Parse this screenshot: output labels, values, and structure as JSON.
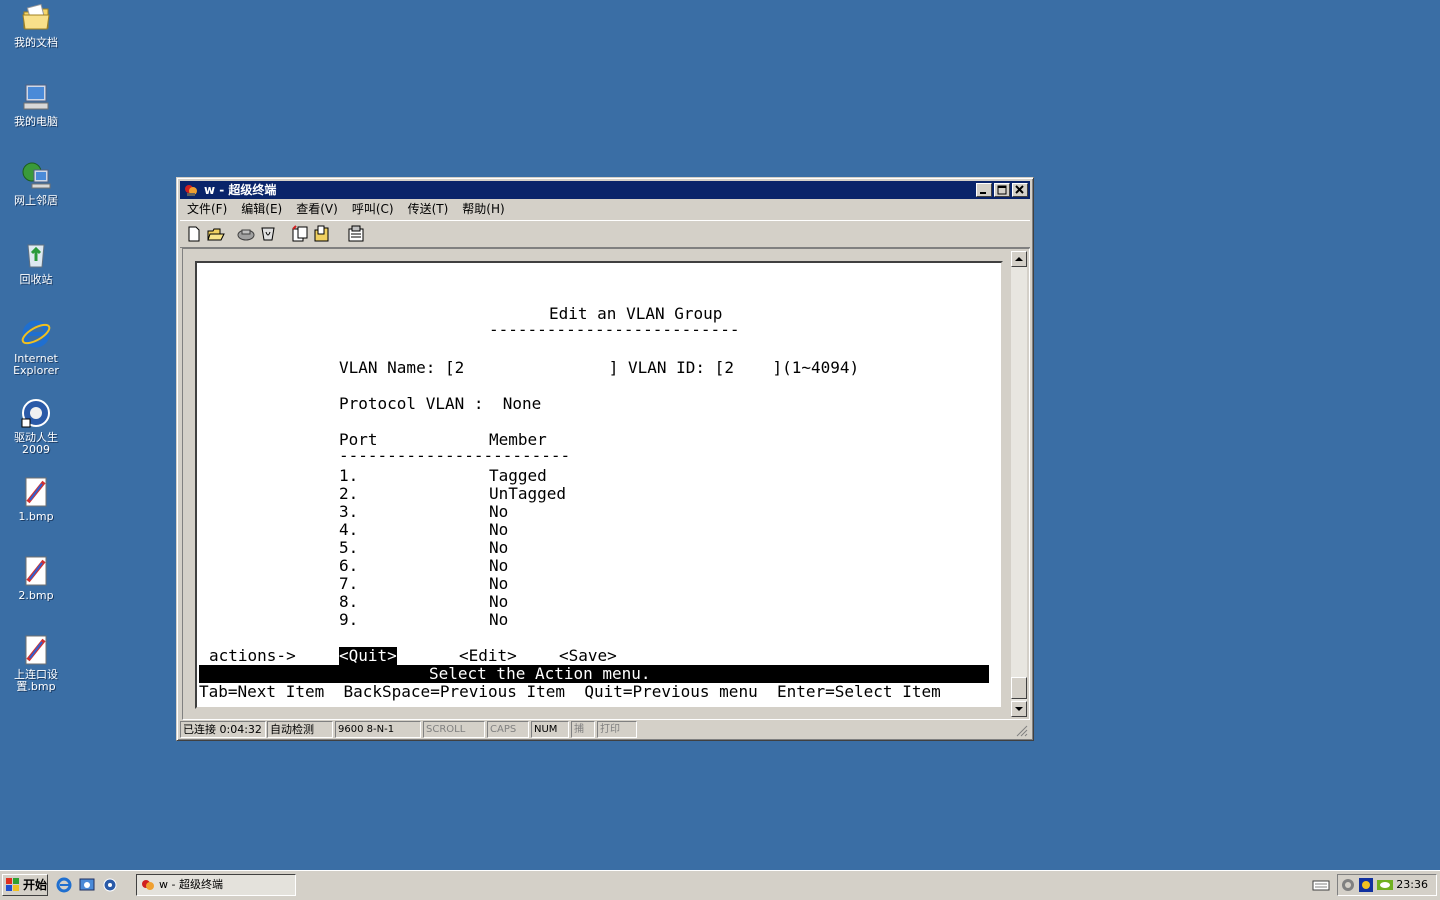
{
  "desktop": {
    "icons": [
      {
        "label": "我的文档"
      },
      {
        "label": "我的电脑"
      },
      {
        "label": "网上邻居"
      },
      {
        "label": "回收站"
      },
      {
        "label": "Internet Explorer"
      },
      {
        "label": "驱动人生2009"
      },
      {
        "label": "1.bmp"
      },
      {
        "label": "2.bmp"
      },
      {
        "label": "上连口设置.bmp"
      }
    ]
  },
  "window": {
    "title": "w - 超级终端",
    "menu": [
      "文件(F)",
      "编辑(E)",
      "查看(V)",
      "呼叫(C)",
      "传送(T)",
      "帮助(H)"
    ],
    "toolbar_icons": [
      "new-icon",
      "open-icon",
      "disconnect-icon",
      "dial-icon",
      "send-icon",
      "receive-icon",
      "properties-icon"
    ]
  },
  "terminal": {
    "heading": "Edit an VLAN Group",
    "heading_rule": "--------------------------",
    "vlan_line": "VLAN Name: [2               ] VLAN ID: [2    ](1~4094)",
    "protocol_line": "Protocol VLAN :  None",
    "col_port": "Port",
    "col_member": "Member",
    "table_rule": "------------------------",
    "ports": [
      {
        "port": "1.",
        "member": "Tagged"
      },
      {
        "port": "2.",
        "member": "UnTagged"
      },
      {
        "port": "3.",
        "member": "No"
      },
      {
        "port": "4.",
        "member": "No"
      },
      {
        "port": "5.",
        "member": "No"
      },
      {
        "port": "6.",
        "member": "No"
      },
      {
        "port": "7.",
        "member": "No"
      },
      {
        "port": "8.",
        "member": "No"
      },
      {
        "port": "9.",
        "member": "No"
      }
    ],
    "actions_label": "actions->",
    "action_quit": "<Quit>",
    "action_edit": "<Edit>",
    "action_save": "<Save>",
    "prompt": "Select the Action menu.",
    "help_line": "Tab=Next Item  BackSpace=Previous Item  Quit=Previous menu  Enter=Select Item"
  },
  "statusbar": {
    "connected": "已连接 0:04:32",
    "detect": "自动检测",
    "settings": "9600 8-N-1",
    "scroll": "SCROLL",
    "caps": "CAPS",
    "num": "NUM",
    "capture": "捕",
    "print": "打印"
  },
  "taskbar": {
    "start": "开始",
    "task_title": "w - 超级终端",
    "clock": "23:36"
  }
}
